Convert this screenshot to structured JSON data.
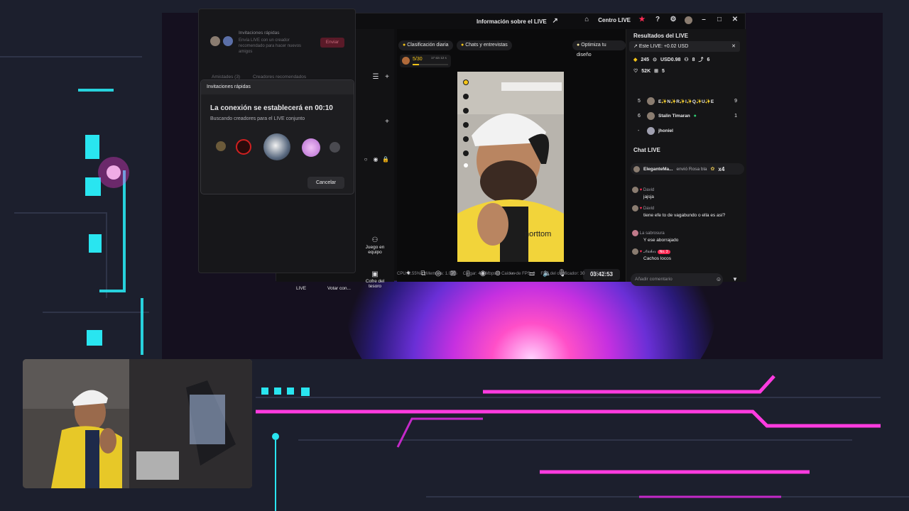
{
  "app": {
    "title": "Información sobre el LIVE",
    "centro_label": "Centro LIVE"
  },
  "left_panel": {
    "invite_title": "Invitaciones rápidas",
    "invite_desc": "Envía LIVE con un creador recomendado para hacer nuevos amigos",
    "send_label": "Enviar",
    "tab_friends": "Amistades (3)",
    "tab_recommended": "Creadores recomendados",
    "team_label": "Juego en equipo",
    "chest_label": "Cofre del tesoro",
    "live_tab": "LIVE",
    "vote_tab": "Votar con..."
  },
  "dialog": {
    "header": "Invitaciones rápidas",
    "heading": "La conexión se establecerá en 00:10",
    "subtitle": "Buscando creadores para el LIVE conjunto",
    "cancel_label": "Cancelar"
  },
  "video_area": {
    "ranking_pill": "Clasificación diaria",
    "chats_pill": "Chats y entrevistas",
    "optimize_pill": "Optimiza tu diseño",
    "progress_text": "5/30",
    "progress_time": "17 sin 12 s",
    "progress_value": 0.17,
    "timer": "03:42:53",
    "stats": {
      "cpu": "CPU: 2.55%",
      "memory": "Memoria: 1.07%",
      "load": "Cargar: 4.0 Mbps",
      "fps_drops": "Caídas de FPS: 0",
      "encoder_fps": "FPS del codificador: 30",
      "fps": "FPS: 30"
    }
  },
  "results": {
    "title": "Resultados del LIVE",
    "this_live": "Este LIVE: +0.02 USD",
    "coins": "245",
    "usd": "USD0.98",
    "viewers_a": "8",
    "shares": "6",
    "likes": "52K",
    "gifts": "5",
    "leaderboard": [
      {
        "rank": "5",
        "name": "E✨N✨R✨I✨Q✨U✨E",
        "score": "9"
      },
      {
        "rank": "6",
        "name": "Stalin Timaran",
        "score": "1"
      },
      {
        "rank": "-",
        "name": "jhoniel",
        "score": ""
      }
    ]
  },
  "chat": {
    "title": "Chat LIVE",
    "gift_user": "EleganteMa...",
    "gift_text": "envió Rosa bla",
    "gift_count": "x4",
    "messages": [
      {
        "name": "David",
        "text": "jajsja"
      },
      {
        "name": "David",
        "text": "tiene efe to de vagabundo o ella es así?"
      },
      {
        "name": "La sabrosura",
        "text": "Y ese aborrajado"
      },
      {
        "name": "𝓝𝓪𝓱𝓲𝓻",
        "badge": "No. 3",
        "text": "Cachos locos"
      }
    ],
    "comment_placeholder": "Añadir comentario"
  },
  "colors": {
    "accent_red": "#fe2c55",
    "neon_cyan": "#29e5f0",
    "neon_pink": "#ff3be0"
  }
}
